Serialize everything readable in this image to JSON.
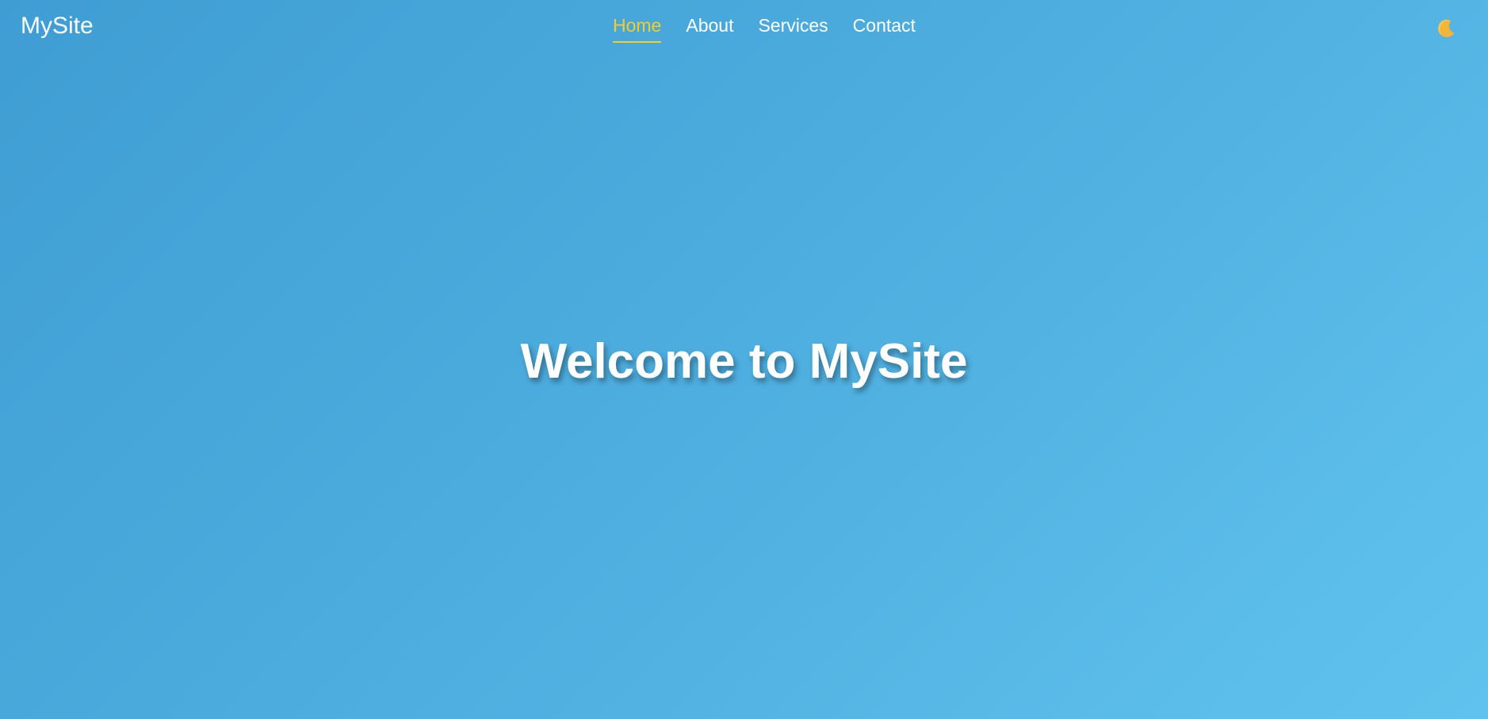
{
  "header": {
    "logo": "MySite",
    "nav": [
      {
        "label": "Home",
        "active": true
      },
      {
        "label": "About",
        "active": false
      },
      {
        "label": "Services",
        "active": false
      },
      {
        "label": "Contact",
        "active": false
      }
    ],
    "theme_toggle_icon": "crescent-moon-icon"
  },
  "hero": {
    "title": "Welcome to MySite"
  },
  "colors": {
    "accent": "#f4cd2a",
    "background_start": "#3f9dd3",
    "background_end": "#60c3ee",
    "text": "#ffffff"
  }
}
